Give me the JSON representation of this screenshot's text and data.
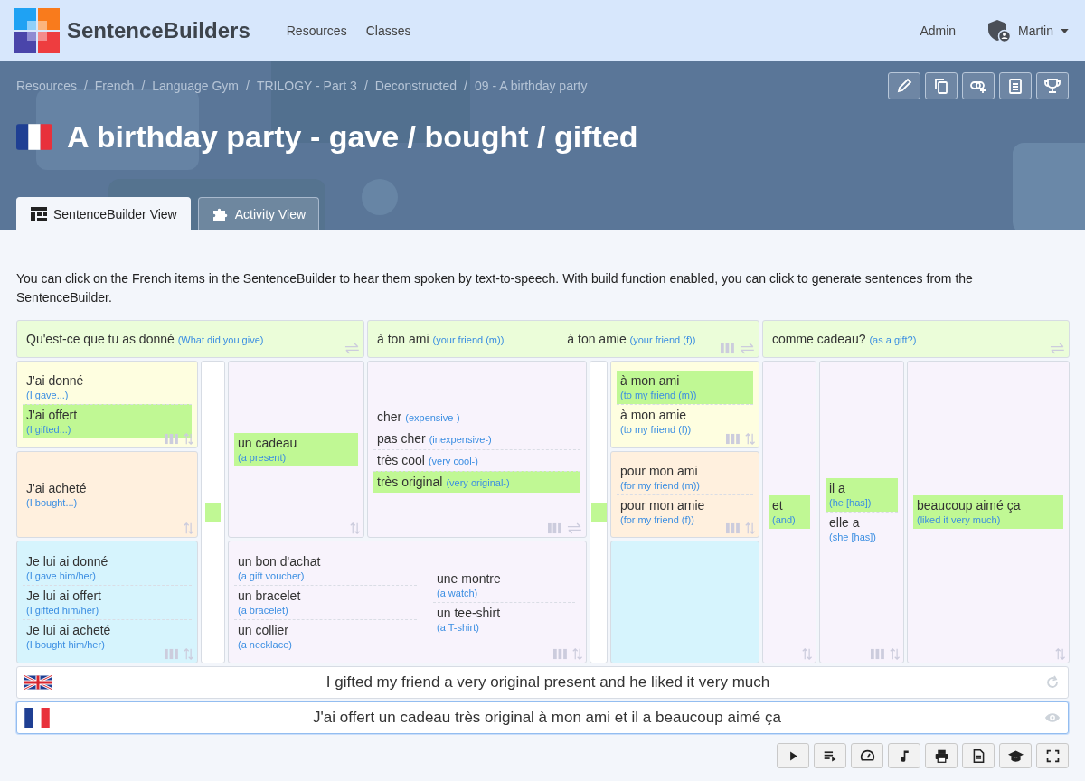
{
  "brand": "SentenceBuilders",
  "nav": [
    "Resources",
    "Classes"
  ],
  "user_menu": {
    "admin": "Admin",
    "user": "Martin"
  },
  "breadcrumb": {
    "separator": "/",
    "items": [
      "Resources",
      "French",
      "Language Gym",
      "TRILOGY - Part 3",
      "Deconstructed",
      "09 - A birthday party"
    ]
  },
  "title": "A birthday party - gave / bought / gifted",
  "tabs": [
    {
      "label": "SentenceBuilder View",
      "selected": true
    },
    {
      "label": "Activity View",
      "selected": false
    }
  ],
  "intro": "You can click on the French items in the SentenceBuilder to hear them spoken by text-to-speech. With build function enabled, you can click to generate sentences from the SentenceBuilder.",
  "headers": [
    {
      "color": "#ebfdd9",
      "tools": [
        {
          "kind": "swap"
        }
      ],
      "phrases": [
        {
          "fr": "Qu'est-ce que tu as donné",
          "en": "(What did you give)"
        }
      ]
    },
    {
      "color": "#ebfdd9",
      "tools": [
        {
          "kind": "columns"
        },
        {
          "kind": "swap"
        }
      ],
      "phrases": [
        {
          "fr": "à ton ami",
          "en": "(your friend (m))"
        },
        {
          "fr": "à ton amie",
          "en": "(your friend (f))"
        }
      ]
    },
    {
      "color": "#ebfdd9",
      "tools": [
        {
          "kind": "swap"
        }
      ],
      "phrases": [
        {
          "fr": "comme cadeau?",
          "en": "(as a gift?)"
        }
      ]
    }
  ],
  "cells": [
    {
      "kind": "options",
      "color": "#fefee0",
      "tools": [
        {
          "kind": "columns"
        },
        {
          "kind": "updown"
        }
      ],
      "items": [
        {
          "fr": "J'ai donné",
          "en": "(I gave...)",
          "selected": false
        },
        {
          "fr": "J'ai offert",
          "en": "(I gifted...)",
          "selected": true
        }
      ]
    },
    {
      "kind": "options",
      "color": "#fff0de",
      "tools": [
        {
          "kind": "updown"
        }
      ],
      "items": [
        {
          "fr": "J'ai acheté",
          "en": "(I bought...)",
          "selected": false
        }
      ]
    },
    {
      "kind": "options",
      "color": "#d6f4fd",
      "tools": [
        {
          "kind": "columns"
        },
        {
          "kind": "updown"
        }
      ],
      "items": [
        {
          "fr": "Je lui ai donné",
          "en": "(I gave him/her)",
          "selected": false
        },
        {
          "fr": "Je lui ai offert",
          "en": "(I gifted him/her)",
          "selected": false
        },
        {
          "fr": "Je lui ai acheté",
          "en": "(I bought him/her)",
          "selected": false
        }
      ]
    },
    {
      "kind": "connector",
      "color": "#ffffff",
      "marked": true
    },
    {
      "kind": "options",
      "color": "#f8f3fc",
      "tools": [
        {
          "kind": "updown"
        }
      ],
      "items": [
        {
          "fr": "un cadeau",
          "en": "(a present)",
          "selected": true
        }
      ]
    },
    {
      "kind": "inline",
      "color": "#f8f3fc",
      "tools": [
        {
          "kind": "columns"
        },
        {
          "kind": "swap"
        }
      ],
      "items": [
        {
          "fr": "cher",
          "en": "(expensive-)",
          "selected": false
        },
        {
          "fr": "pas cher",
          "en": "(inexpensive-)",
          "selected": false
        },
        {
          "fr": "très cool",
          "en": "(very cool-)",
          "selected": false
        },
        {
          "fr": "très original",
          "en": "(very original-)",
          "selected": true
        }
      ]
    },
    {
      "kind": "two_columns",
      "color": "#f8f3fc",
      "tools": [
        {
          "kind": "columns"
        },
        {
          "kind": "updown"
        }
      ],
      "columns": [
        [
          {
            "fr": "un bon d'achat",
            "en": "(a gift voucher)",
            "selected": false
          },
          {
            "fr": "un bracelet",
            "en": "(a bracelet)",
            "selected": false
          },
          {
            "fr": "un collier",
            "en": "(a necklace)",
            "selected": false
          }
        ],
        [
          {
            "fr": "une montre",
            "en": "(a watch)",
            "selected": false
          },
          {
            "fr": "un tee-shirt",
            "en": "(a T-shirt)",
            "selected": false
          }
        ]
      ]
    },
    {
      "kind": "connector",
      "color": "#ffffff",
      "marked": true
    },
    {
      "kind": "options",
      "color": "#fefee0",
      "tools": [
        {
          "kind": "columns"
        },
        {
          "kind": "updown"
        }
      ],
      "items": [
        {
          "fr": "à mon ami",
          "en": "(to my friend (m))",
          "selected": true
        },
        {
          "fr": "à mon amie",
          "en": "(to my friend (f))",
          "selected": false
        }
      ]
    },
    {
      "kind": "options",
      "color": "#fff0de",
      "tools": [
        {
          "kind": "columns"
        },
        {
          "kind": "updown"
        }
      ],
      "items": [
        {
          "fr": "pour mon ami",
          "en": "(for my friend (m))",
          "selected": false
        },
        {
          "fr": "pour mon amie",
          "en": "(for my friend (f))",
          "selected": false
        }
      ]
    },
    {
      "kind": "empty",
      "color": "#d6f4fd"
    },
    {
      "kind": "options",
      "color": "#f8f3fc",
      "tools": [
        {
          "kind": "updown"
        }
      ],
      "items": [
        {
          "fr": "et",
          "en": "(and)",
          "selected": true
        }
      ]
    },
    {
      "kind": "options",
      "color": "#f8f3fc",
      "tools": [
        {
          "kind": "columns"
        },
        {
          "kind": "updown"
        }
      ],
      "items": [
        {
          "fr": "il a",
          "en": "(he [has])",
          "selected": true
        },
        {
          "fr": "elle a",
          "en": "(she [has])",
          "selected": false
        }
      ]
    },
    {
      "kind": "options",
      "color": "#f8f3fc",
      "tools": [
        {
          "kind": "updown"
        }
      ],
      "items": [
        {
          "fr": "beaucoup aimé ça",
          "en": "(liked it very much)",
          "selected": true
        }
      ]
    }
  ],
  "sentences": [
    {
      "kind": "english",
      "text": "I gifted my friend a very original present and he liked it very much",
      "focused": false
    },
    {
      "kind": "french",
      "text": "J'ai offert un cadeau très original à mon ami et il a beaucoup aimé ça",
      "focused": true
    }
  ]
}
